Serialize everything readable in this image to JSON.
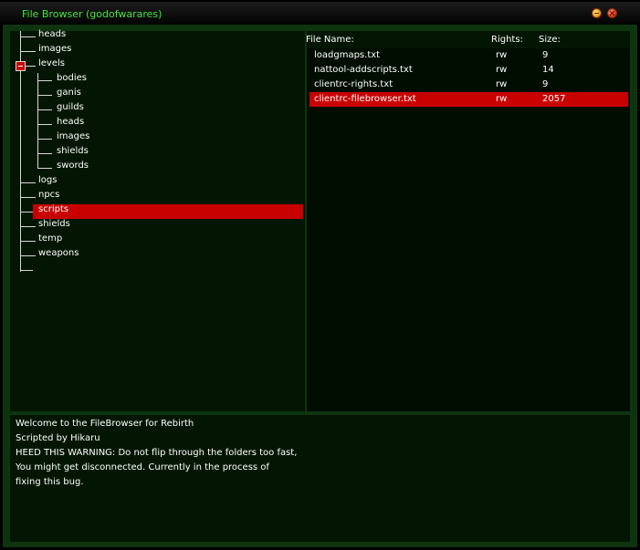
{
  "window": {
    "title": "File Browser (godofwarares)"
  },
  "tree": {
    "items": [
      {
        "label": "heads",
        "depth": 1
      },
      {
        "label": "images",
        "depth": 1
      },
      {
        "label": "levels",
        "depth": 1,
        "expanded": true
      },
      {
        "label": "bodies",
        "depth": 2
      },
      {
        "label": "ganis",
        "depth": 2
      },
      {
        "label": "guilds",
        "depth": 2
      },
      {
        "label": "heads",
        "depth": 2
      },
      {
        "label": "images",
        "depth": 2
      },
      {
        "label": "shields",
        "depth": 2
      },
      {
        "label": "swords",
        "depth": 2
      },
      {
        "label": "logs",
        "depth": 1
      },
      {
        "label": "npcs",
        "depth": 1
      },
      {
        "label": "scripts",
        "depth": 1,
        "selected": true
      },
      {
        "label": "shields",
        "depth": 1
      },
      {
        "label": "temp",
        "depth": 1
      },
      {
        "label": "weapons",
        "depth": 1
      }
    ]
  },
  "files": {
    "headers": {
      "name": "File Name:",
      "rights": "Rights:",
      "size": "Size:"
    },
    "rows": [
      {
        "name": "loadgmaps.txt",
        "rights": "rw",
        "size": "9"
      },
      {
        "name": "nattool-addscripts.txt",
        "rights": "rw",
        "size": "14"
      },
      {
        "name": "clientrc-rights.txt",
        "rights": "rw",
        "size": "9"
      },
      {
        "name": "clientrc-filebrowser.txt",
        "rights": "rw",
        "size": "2057",
        "selected": true
      }
    ]
  },
  "log": {
    "lines": [
      "Welcome to the FileBrowser for Rebirth",
      "Scripted by Hikaru",
      "HEED THIS WARNING: Do not flip through the folders too fast,",
      "You might get disconnected. Currently in the process of",
      "fixing this bug."
    ]
  },
  "colors": {
    "title_text": "#41e63c",
    "selection": "#c90000",
    "pane_bg": "#031603",
    "frame_bg": "#0e3410"
  },
  "icons": {
    "collapse": "minus-box-icon",
    "minimize": "minimize-icon",
    "close": "close-icon"
  }
}
